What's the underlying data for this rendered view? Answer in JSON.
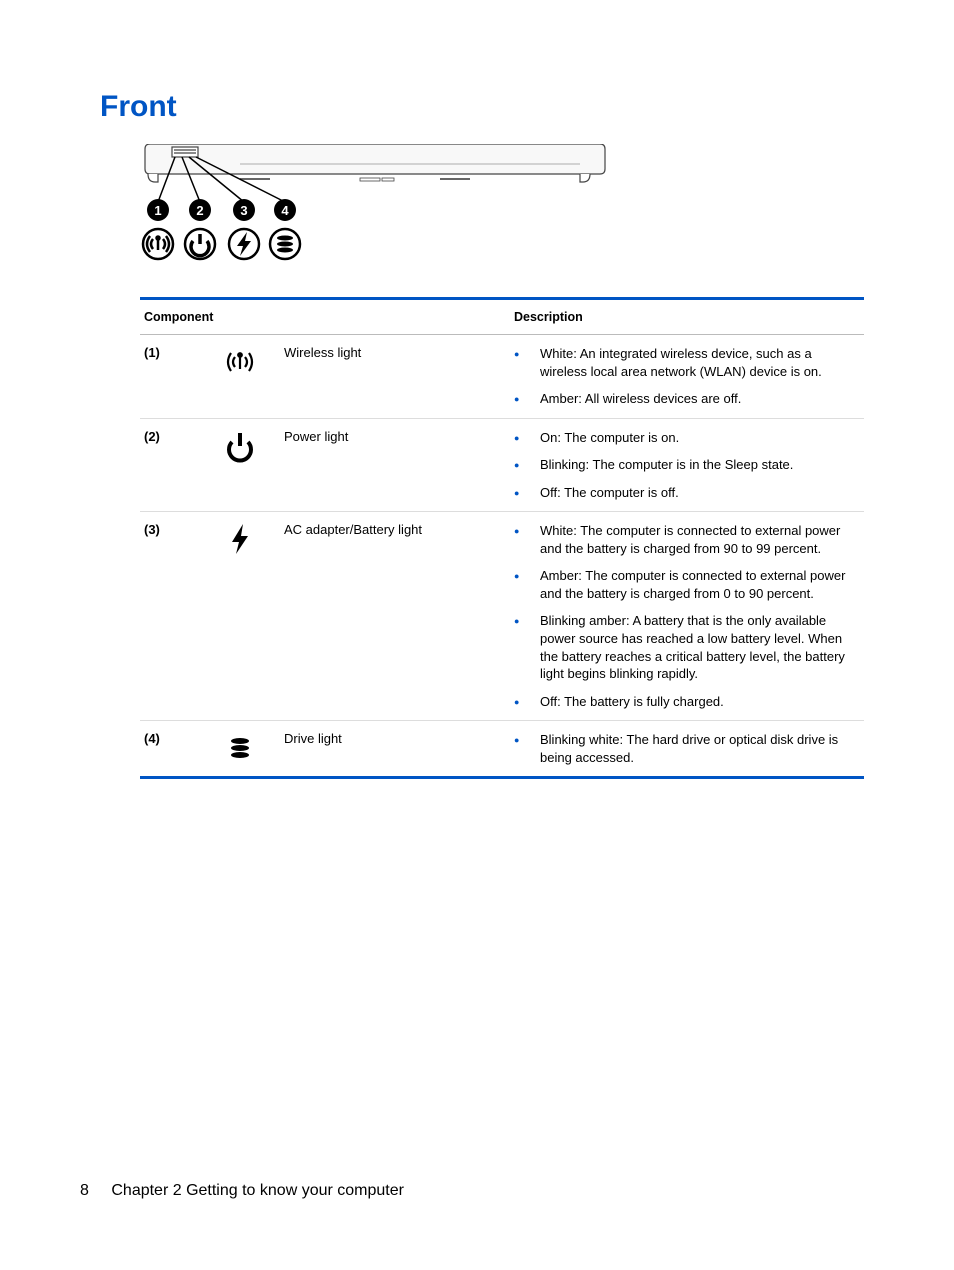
{
  "heading": "Front",
  "table": {
    "headers": {
      "component": "Component",
      "description": "Description"
    },
    "rows": [
      {
        "num": "(1)",
        "icon": "wireless-icon",
        "name": "Wireless light",
        "desc": [
          "White: An integrated wireless device, such as a wireless local area network (WLAN) device is on.",
          "Amber: All wireless devices are off."
        ]
      },
      {
        "num": "(2)",
        "icon": "power-icon",
        "name": "Power light",
        "desc": [
          "On: The computer is on.",
          "Blinking: The computer is in the Sleep state.",
          "Off: The computer is off."
        ]
      },
      {
        "num": "(3)",
        "icon": "battery-icon",
        "name": "AC adapter/Battery light",
        "desc": [
          "White: The computer is connected to external power and the battery is charged from 90 to 99 percent.",
          "Amber: The computer is connected to external power and the battery is charged from 0 to 90 percent.",
          "Blinking amber: A battery that is the only available power source has reached a low battery level. When the battery reaches a critical battery level, the battery light begins blinking rapidly.",
          "Off: The battery is fully charged."
        ]
      },
      {
        "num": "(4)",
        "icon": "drive-icon",
        "name": "Drive light",
        "desc": [
          "Blinking white: The hard drive or optical disk drive is being accessed."
        ]
      }
    ]
  },
  "footer": {
    "pagenum": "8",
    "chapter": "Chapter 2   Getting to know your computer"
  }
}
